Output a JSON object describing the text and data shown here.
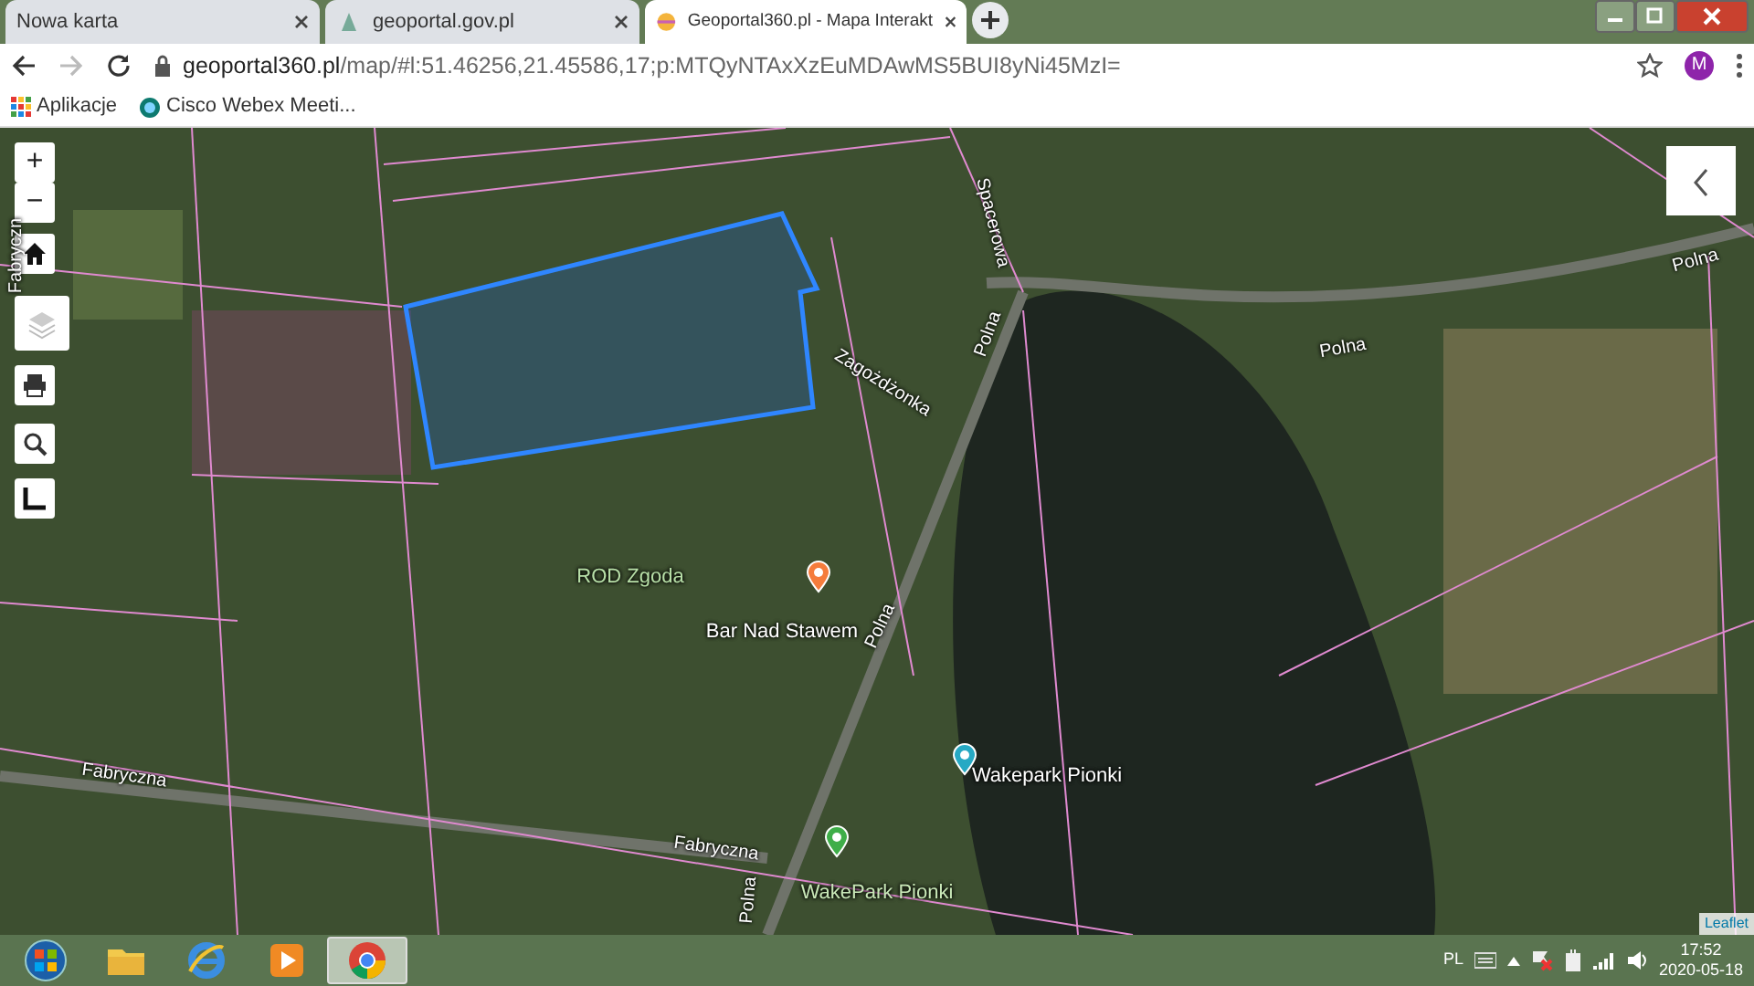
{
  "tabs": [
    {
      "title": "Nowa karta",
      "kind": "blank",
      "selected": false
    },
    {
      "title": "geoportal.gov.pl",
      "kind": "gov",
      "selected": false
    },
    {
      "title": "Geoportal360.pl - Mapa Interakt",
      "kind": "geo360",
      "selected": true
    }
  ],
  "address_bar": {
    "host": "geoportal360.pl",
    "path": "/map/#l:51.46256,21.45586,17;p:MTQyNTAxXzEuMDAwMS5BUI8yNi45MzI="
  },
  "profile": {
    "initial": "M"
  },
  "bookmarks": [
    {
      "label": "Aplikacje",
      "kind": "apps"
    },
    {
      "label": "Cisco Webex Meeti...",
      "kind": "webex"
    }
  ],
  "map": {
    "controls": [
      {
        "kind": "zoom-in",
        "label": "+"
      },
      {
        "kind": "zoom-out",
        "label": "−"
      },
      {
        "kind": "home"
      },
      {
        "kind": "layers"
      },
      {
        "kind": "print"
      },
      {
        "kind": "search"
      },
      {
        "kind": "measure"
      }
    ],
    "labels": [
      {
        "text": "Fabryczn",
        "kind": "street"
      },
      {
        "text": "Zagożdżonka",
        "kind": "street"
      },
      {
        "text": "Spacerowa",
        "kind": "street"
      },
      {
        "text": "Polna",
        "kind": "street"
      },
      {
        "text": "Polna",
        "kind": "street"
      },
      {
        "text": "Polna",
        "kind": "street"
      },
      {
        "text": "ROD Zgoda",
        "kind": "place"
      },
      {
        "text": "Bar Nad Stawem",
        "kind": "bar"
      },
      {
        "text": "Polna",
        "kind": "street"
      },
      {
        "text": "Wakepark Pionki",
        "kind": "sport"
      },
      {
        "text": "Fabryczna",
        "kind": "street"
      },
      {
        "text": "Fabryczna",
        "kind": "street"
      },
      {
        "text": "WakePark Pionki",
        "kind": "park"
      },
      {
        "text": "Polna",
        "kind": "street"
      }
    ],
    "attribution": "Leaflet"
  },
  "taskbar": {
    "apps": [
      {
        "kind": "start",
        "selected": false
      },
      {
        "kind": "folder",
        "selected": false
      },
      {
        "kind": "ie",
        "selected": false
      },
      {
        "kind": "media",
        "selected": false
      },
      {
        "kind": "chrome",
        "selected": true
      }
    ],
    "language": "PL",
    "time": "17:52",
    "date": "2020-05-18"
  }
}
